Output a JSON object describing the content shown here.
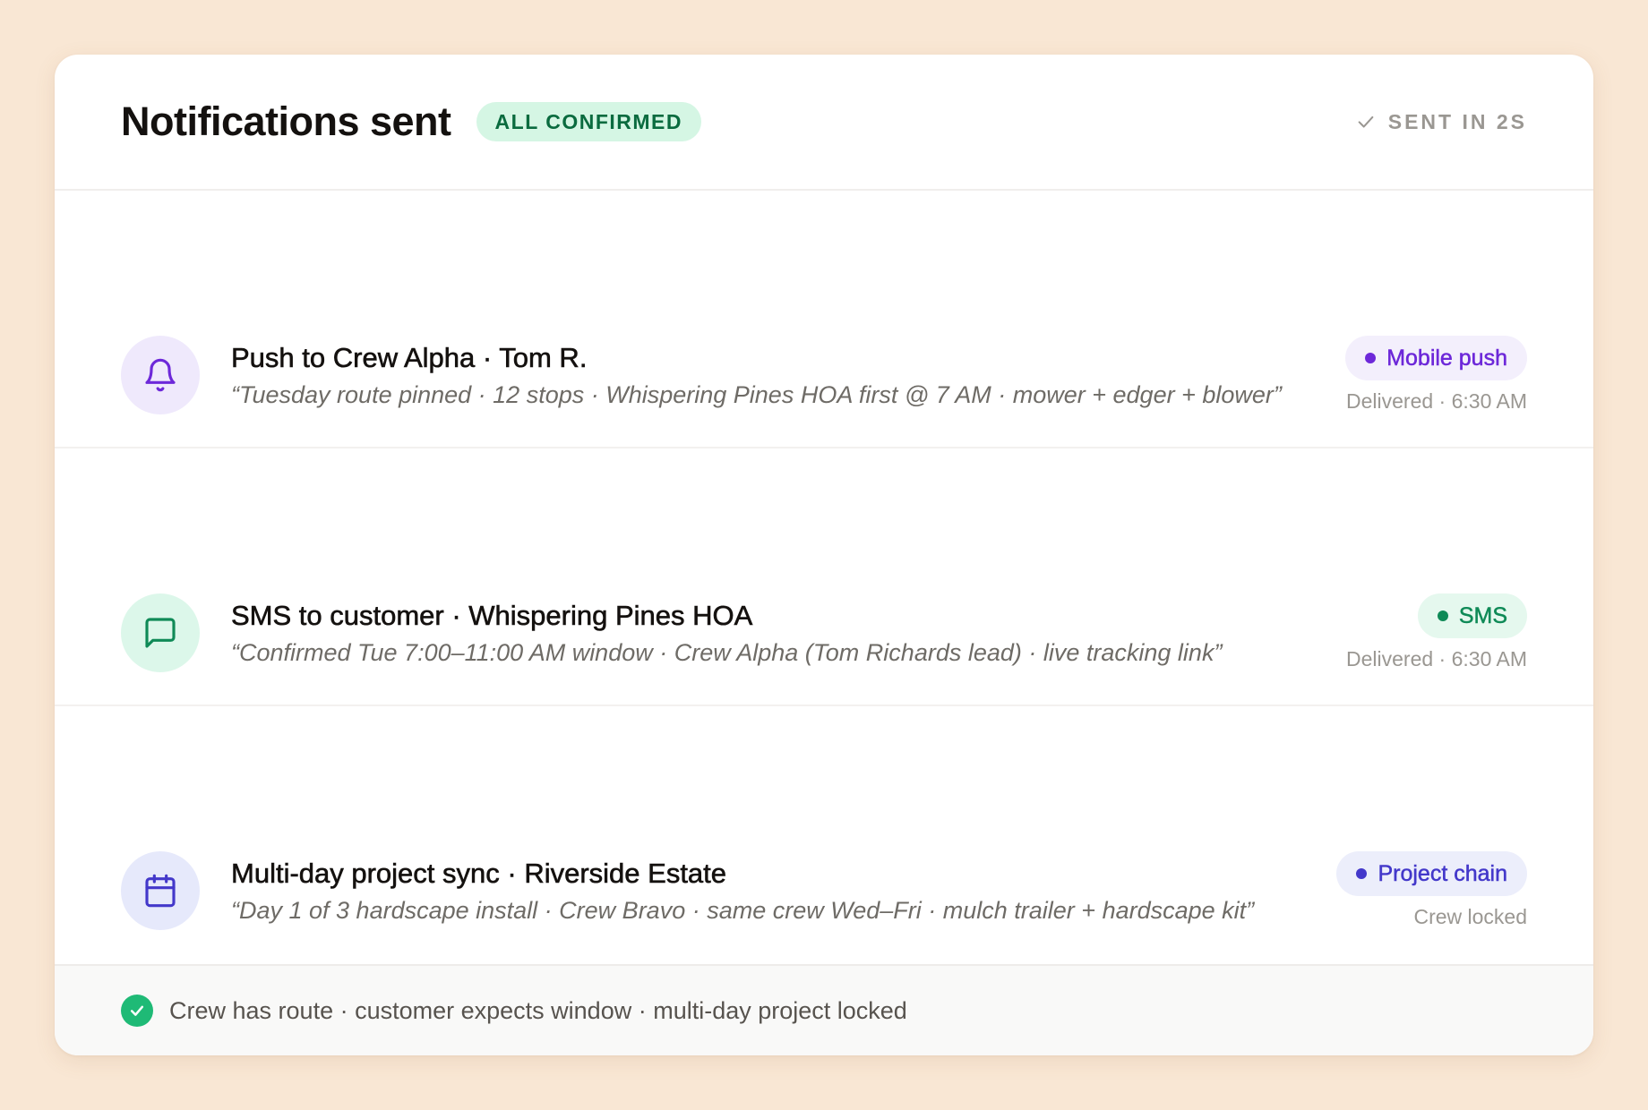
{
  "header": {
    "title": "Notifications sent",
    "badge": "ALL CONFIRMED",
    "status_icon": "check-icon",
    "status": "SENT IN 2S"
  },
  "notifications": [
    {
      "icon": "bell-icon",
      "icon_color": "#6d28d9",
      "icon_bg": "#efe9fc",
      "title": "Push to Crew Alpha · Tom R.",
      "quote": "“Tuesday route pinned · 12 stops · Whispering Pines HOA first @ 7 AM · mower + edger + blower”",
      "channel": "Mobile push",
      "channel_color": "#6d28d9",
      "channel_bg": "#f3effc",
      "status": "Delivered · 6:30 AM"
    },
    {
      "icon": "chat-bubble-icon",
      "icon_color": "#0f8a57",
      "icon_bg": "#dcf7ea",
      "title": "SMS to customer · Whispering Pines HOA",
      "quote": "“Confirmed Tue 7:00–11:00 AM window · Crew Alpha (Tom Richards lead) · live tracking link”",
      "channel": "SMS",
      "channel_color": "#0f8a57",
      "channel_bg": "#e5f8ee",
      "status": "Delivered · 6:30 AM"
    },
    {
      "icon": "calendar-icon",
      "icon_color": "#4338ca",
      "icon_bg": "#e6e9fb",
      "title": "Multi-day project sync · Riverside Estate",
      "quote": "“Day 1 of 3 hardscape install · Crew Bravo · same crew Wed–Fri · mulch trailer + hardscape kit”",
      "channel": "Project chain",
      "channel_color": "#4338ca",
      "channel_bg": "#eceefb",
      "status": "Crew locked"
    }
  ],
  "footer": {
    "icon": "check-circle-icon",
    "text": "Crew has route · customer expects window · multi-day project locked"
  }
}
